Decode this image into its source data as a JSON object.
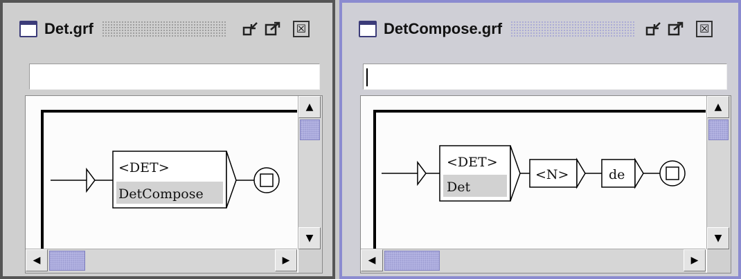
{
  "windows": {
    "left": {
      "title": "Det.grf",
      "close_label": "☒",
      "graph": {
        "box1_line1": "<DET>",
        "box1_line2": "DetCompose"
      }
    },
    "right": {
      "title": "DetCompose.grf",
      "close_label": "☒",
      "graph": {
        "box1_line1": "<DET>",
        "box1_line2": "Det",
        "box2": "<N>",
        "box3": "de"
      }
    }
  },
  "colors": {
    "active_border": "#8b8bd0",
    "inactive_border": "#5e5e5e",
    "thumb": "#b8b8e6"
  },
  "icons": [
    "window-icon",
    "minimize-icon",
    "maximize-icon",
    "close-icon",
    "arrow-up-icon",
    "arrow-down-icon",
    "arrow-left-icon",
    "arrow-right-icon"
  ]
}
